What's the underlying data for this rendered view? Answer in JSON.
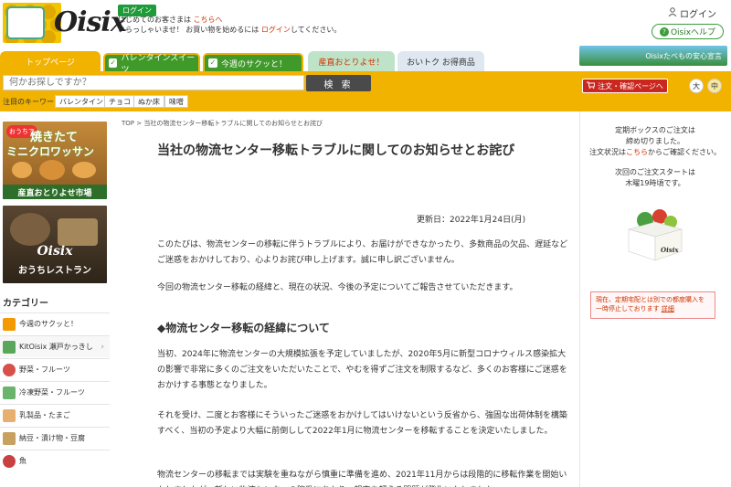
{
  "header": {
    "logo_text": "Oisix",
    "login_badge": "ログイン",
    "hello1_prefix": "はじめてのお客さまは ",
    "hello1_link": "こちらへ",
    "hello2_prefix": "いらっしゃいませ！ お買い物を始めるには ",
    "hello2_link": "ログイン",
    "hello2_suffix": "してください。",
    "login_label": "ログイン",
    "help_label": "Oisixヘルプ"
  },
  "nav": {
    "tab_top": "トップページ",
    "tab_valentine": "バレンタインスイーツ",
    "tab_week": "今週のサクッと！",
    "tab_sanchoku": "産直おとりよせ！",
    "tab_oitoku": "おいトク お得商品",
    "banner_right": "Oisixたべもの安心宣言"
  },
  "search": {
    "placeholder": "何かお探しですか？",
    "button": "検 索",
    "keyword_label": "注目のキーワード",
    "keywords": [
      "バレンタイン",
      "チョコ",
      "ぬか床",
      "味噌"
    ],
    "cart_button": "注文・確認ページへ",
    "size_large": "大",
    "size_medium": "中"
  },
  "sidebar": {
    "promo1_tag": "おうちで",
    "promo1_line1": "焼きたて",
    "promo1_line2": "ミニクロワッサン",
    "promo1_footer": "産直おとりよせ市場",
    "promo2_logo": "Oisix",
    "promo2_footer": "おうちレストラン",
    "category_title": "カテゴリー",
    "categories": [
      {
        "label": "今週のサクッと！",
        "color": "#f29a00"
      },
      {
        "label": "KitOisix 瀬戸かっきし",
        "color": "#5aa65a"
      },
      {
        "label": "野菜・フルーツ",
        "color": "#d8504a"
      },
      {
        "label": "冷凍野菜・フルーツ",
        "color": "#6bb46b"
      },
      {
        "label": "乳製品・たまご",
        "color": "#e8b070"
      },
      {
        "label": "納豆・漬け物・豆腐",
        "color": "#c8a060"
      },
      {
        "label": "魚",
        "color": "#c84040"
      }
    ]
  },
  "main": {
    "breadcrumb_top": "TOP",
    "breadcrumb_sep": ">",
    "breadcrumb_current": "当社の物流センター移転トラブルに関してのお知らせとお詫び",
    "title": "当社の物流センター移転トラブルに関してのお知らせとお詫び",
    "updated": "更新日：2022年1月24日(月)",
    "para1": "このたびは、物流センターの移転に伴うトラブルにより、お届けができなかったり、多数商品の欠品、遅延などご迷惑をおかけしており、心よりお詫び申し上げます。誠に申し訳ございません。",
    "para2": "今回の物流センター移転の経緯と、現在の状況、今後の予定についてご報告させていただきます。",
    "section1": "◆物流センター移転の経緯について",
    "para3": "当初、2024年に物流センターの大規模拡張を予定していましたが、2020年5月に新型コロナウィルス感染拡大の影響で非常に多くのご注文をいただいたことで、やむを得ずご注文を制限するなど、多くのお客様にご迷惑をおかけする事態となりました。",
    "para4": "それを受け、二度とお客様にそういったご迷惑をおかけしてはいけないという反省から、強固な出荷体制を構築すべく、当初の予定より大幅に前倒しして2022年1月に物流センターを移転することを決定いたしました。",
    "para5": "物流センターの移転までは実験を重ねながら慎重に準備を進め、2021年11月からは段階的に移転作業を開始いたしましたが、新しい物流センターの稼働にあたり、想定を超える問題が発生いたしました。"
  },
  "right_panel": {
    "line1": "定期ボックスのご注文は",
    "line2": "締め切りました。",
    "line3_prefix": "注文状況は",
    "line3_link": "こちら",
    "line3_suffix": "からご確認ください。",
    "line4": "次回のご注文スタートは",
    "line5": "木曜19時頃です。",
    "box_logo": "Oisix",
    "notice_text": "現在、定期宅配とは別での都度購入を一時停止しております",
    "notice_link": "詳細"
  }
}
